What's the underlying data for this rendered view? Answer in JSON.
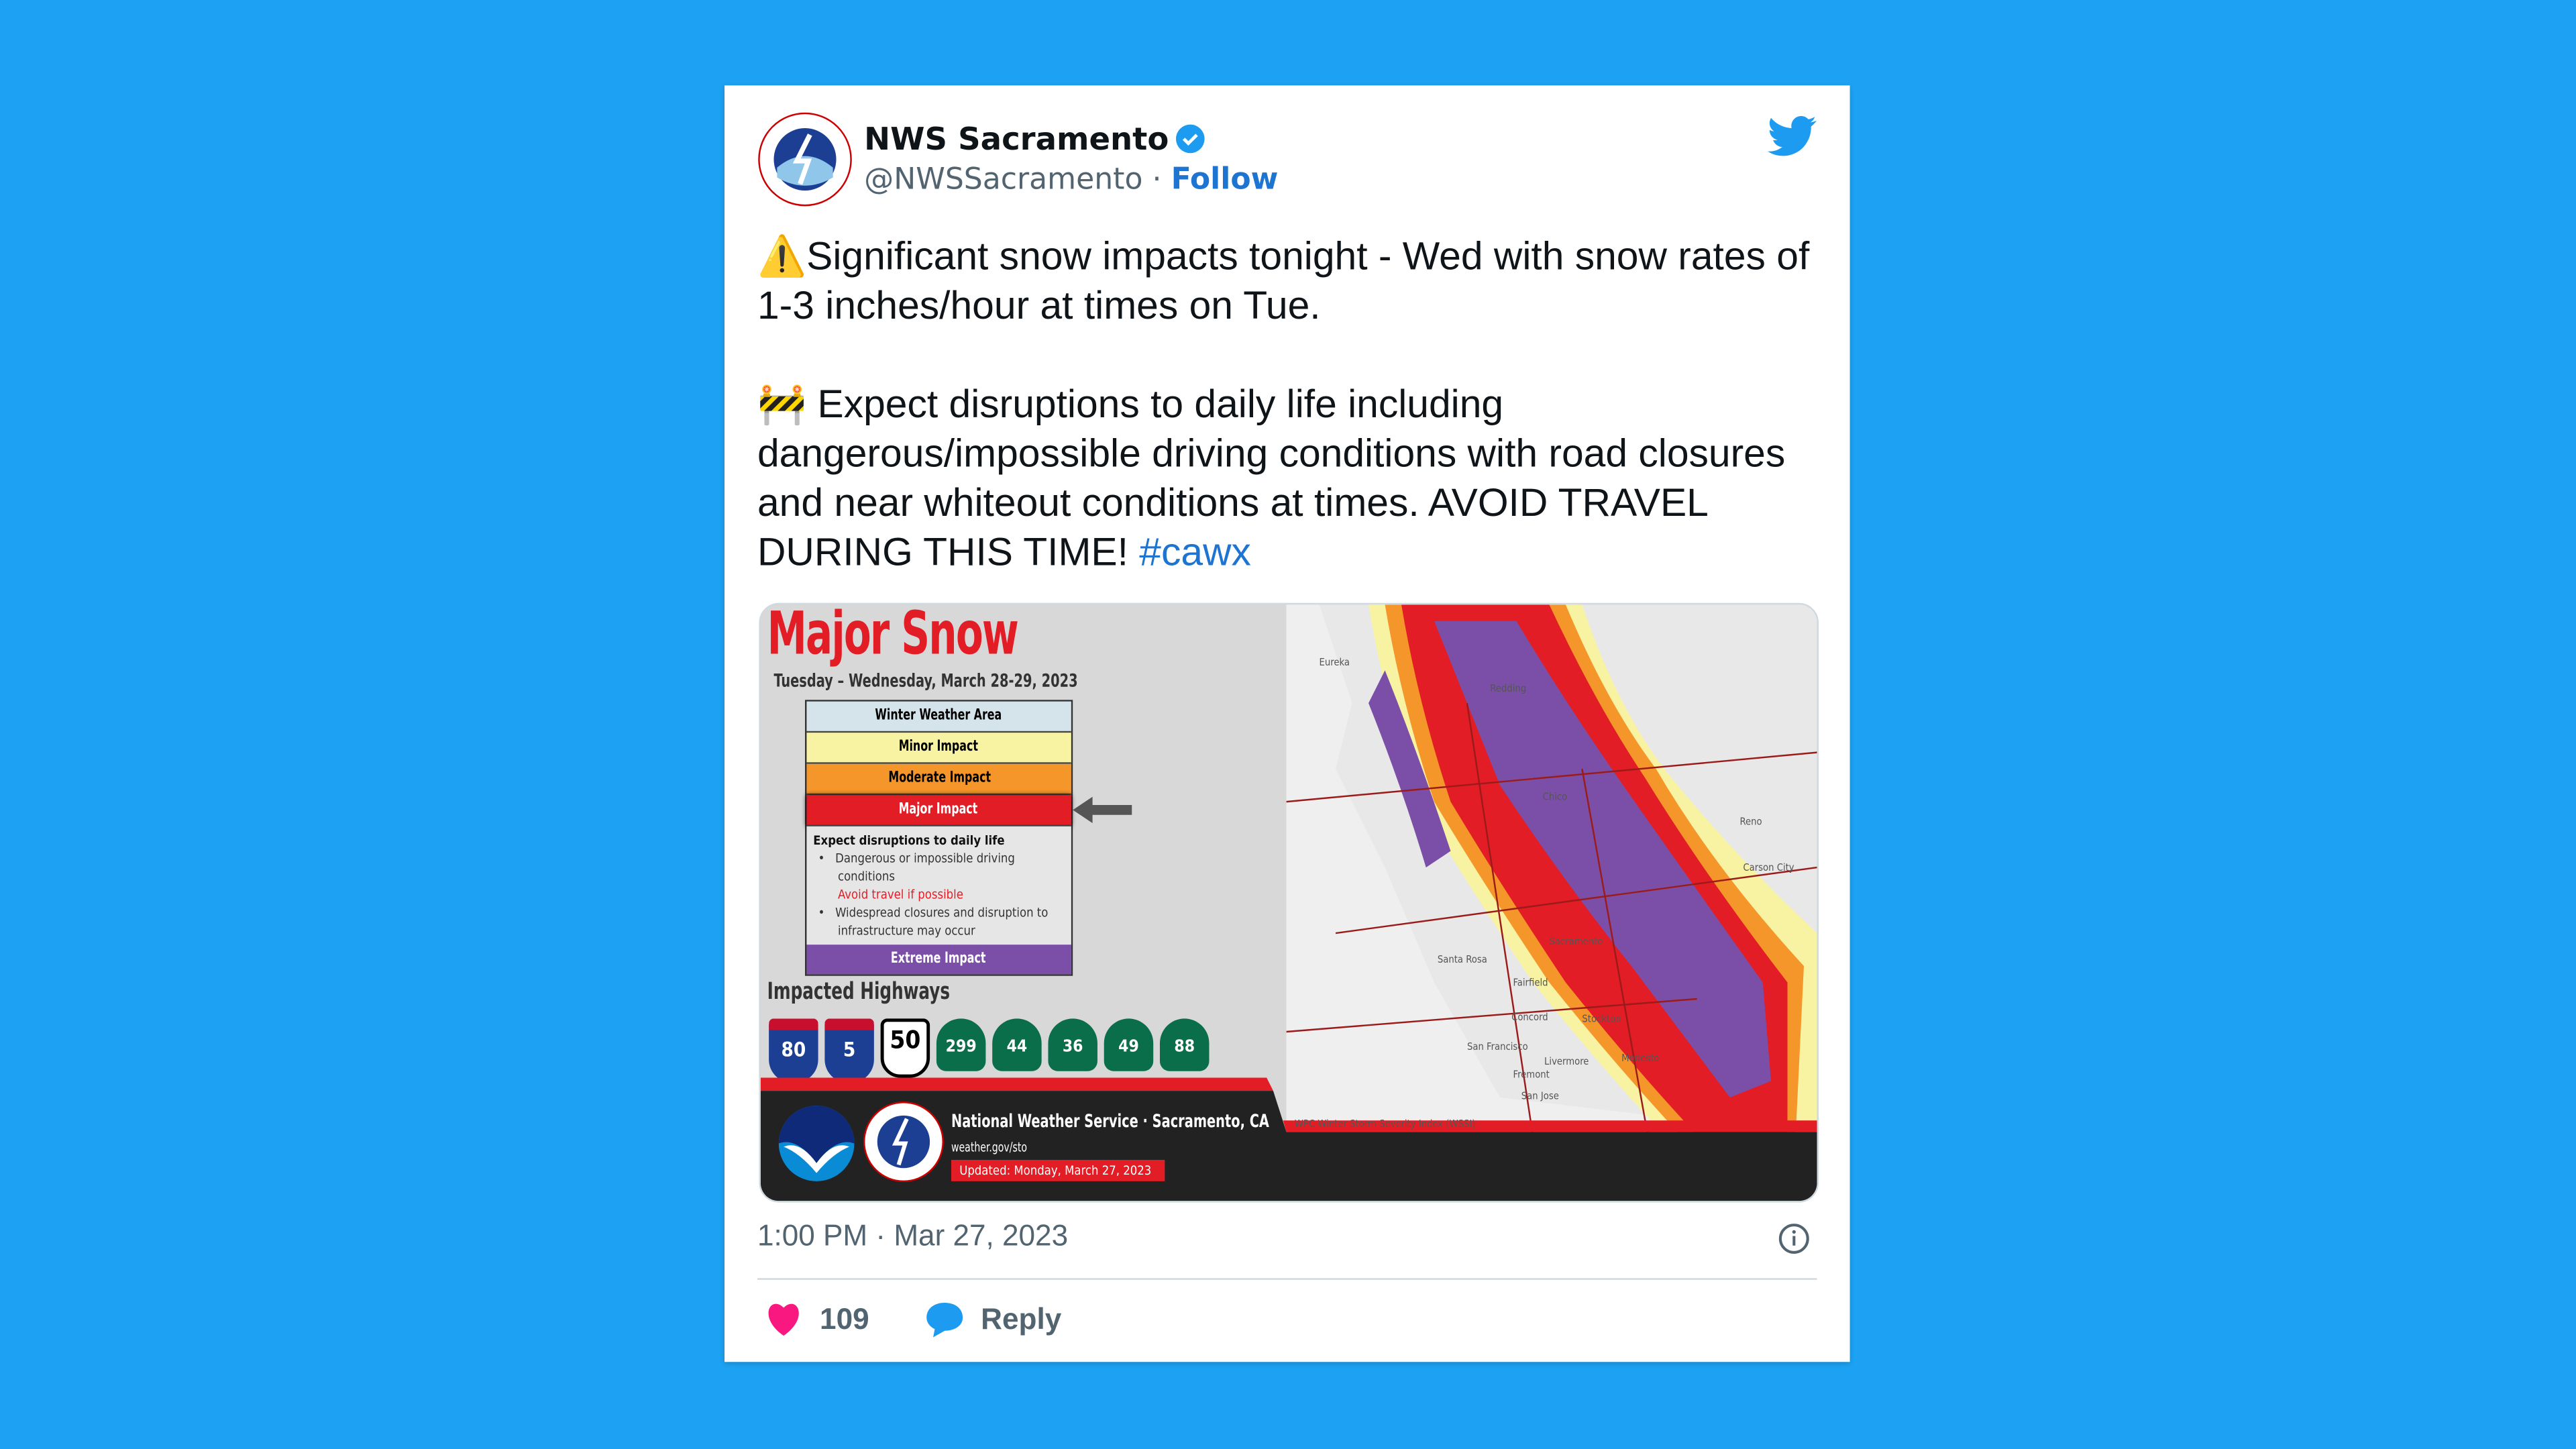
{
  "tweet": {
    "author_name": "NWS Sacramento",
    "handle": "@NWSSacramento",
    "separator": "·",
    "follow_label": "Follow",
    "paragraph1": "⚠️Significant snow impacts tonight - Wed with snow rates of 1-3 inches/hour at times on Tue.",
    "paragraph2": "🚧 Expect disruptions to daily life including dangerous/impossible driving conditions with road closures and near whiteout conditions at times. AVOID TRAVEL DURING THIS TIME! ",
    "hashtag": "#cawx",
    "timestamp": "1:00 PM · Mar 27, 2023",
    "likes": "109",
    "reply_label": "Reply"
  },
  "graphic": {
    "title": "Major Snow",
    "date": "Tuesday – Wednesday, March 28-29, 2023",
    "legend": [
      {
        "label": "Winter Weather Area",
        "color": "#d5e3ea",
        "text": "#111"
      },
      {
        "label": "Minor Impact",
        "color": "#f8f3a2",
        "text": "#111"
      },
      {
        "label": "Moderate Impact",
        "color": "#f5962a",
        "text": "#111"
      },
      {
        "label": "Major Impact",
        "color": "#e31d25",
        "text": "#fff"
      }
    ],
    "description": {
      "heading": "Expect disruptions to daily life",
      "bullet1": "Dangerous or impossible driving conditions",
      "bullet1_note": "Avoid travel if possible",
      "bullet2": "Widespread closures and disruption to infrastructure may occur"
    },
    "extreme_label": "Extreme Impact",
    "extreme_color": "#7b4fa8",
    "highways_title": "Impacted Highways",
    "highways": {
      "interstate": [
        "80",
        "5"
      ],
      "us": [
        "50"
      ],
      "california": [
        "299",
        "44",
        "36",
        "49",
        "88"
      ]
    },
    "map_labels": [
      "Eureka",
      "Redding",
      "Chico",
      "Reno",
      "Carson City",
      "Santa Rosa",
      "Sacramento",
      "Fairfield",
      "Concord",
      "Stockton",
      "San Francisco",
      "Livermore",
      "Modesto",
      "Fremont",
      "San Jose"
    ],
    "map_credit": "WPC Winter Storm Severity Index (WSSI)",
    "footer_org": "National Weather Service · Sacramento, CA",
    "footer_url": "weather.gov/sto",
    "footer_updated": "Updated: Monday, March 27, 2023",
    "logos": [
      "NOAA",
      "NATIONAL WEATHER SERVICE"
    ]
  },
  "colors": {
    "background": "#1da1f2",
    "link": "#1d74d1",
    "like": "#f91880"
  }
}
